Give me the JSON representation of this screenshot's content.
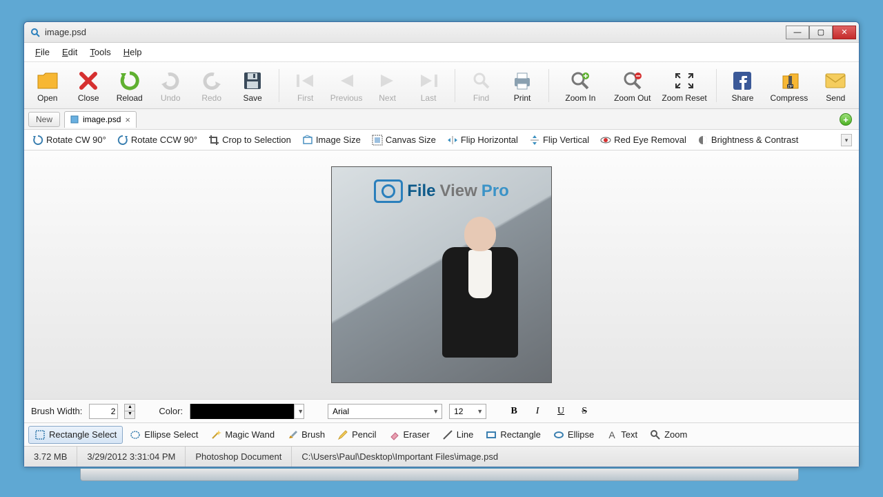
{
  "window": {
    "title": "image.psd"
  },
  "menubar": {
    "file": "File",
    "edit": "Edit",
    "tools": "Tools",
    "help": "Help"
  },
  "toolbar": {
    "open": "Open",
    "close": "Close",
    "reload": "Reload",
    "undo": "Undo",
    "redo": "Redo",
    "save": "Save",
    "first": "First",
    "previous": "Previous",
    "next": "Next",
    "last": "Last",
    "find": "Find",
    "print": "Print",
    "zoom_in": "Zoom In",
    "zoom_out": "Zoom Out",
    "zoom_reset": "Zoom Reset",
    "share": "Share",
    "compress": "Compress",
    "send": "Send"
  },
  "tabs": {
    "new": "New",
    "items": [
      {
        "label": "image.psd"
      }
    ]
  },
  "editbar": {
    "rotate_cw": "Rotate CW 90°",
    "rotate_ccw": "Rotate CCW 90°",
    "crop": "Crop to Selection",
    "image_size": "Image Size",
    "canvas_size": "Canvas Size",
    "flip_h": "Flip Horizontal",
    "flip_v": "Flip Vertical",
    "red_eye": "Red Eye Removal",
    "brightness": "Brightness & Contrast"
  },
  "brand": {
    "p1": "File",
    "p2": "View",
    "p3": "Pro"
  },
  "opts": {
    "brush_width_label": "Brush Width:",
    "brush_width_value": "2",
    "color_label": "Color:",
    "color_value": "#000000",
    "font": "Arial",
    "font_size": "12"
  },
  "tools2": {
    "rect_select": "Rectangle Select",
    "ellipse_select": "Ellipse Select",
    "magic_wand": "Magic Wand",
    "brush": "Brush",
    "pencil": "Pencil",
    "eraser": "Eraser",
    "line": "Line",
    "rectangle": "Rectangle",
    "ellipse": "Ellipse",
    "text": "Text",
    "zoom": "Zoom"
  },
  "status": {
    "size": "3.72 MB",
    "date": "3/29/2012 3:31:04 PM",
    "type": "Photoshop Document",
    "path": "C:\\Users\\Paul\\Desktop\\Important Files\\image.psd"
  }
}
